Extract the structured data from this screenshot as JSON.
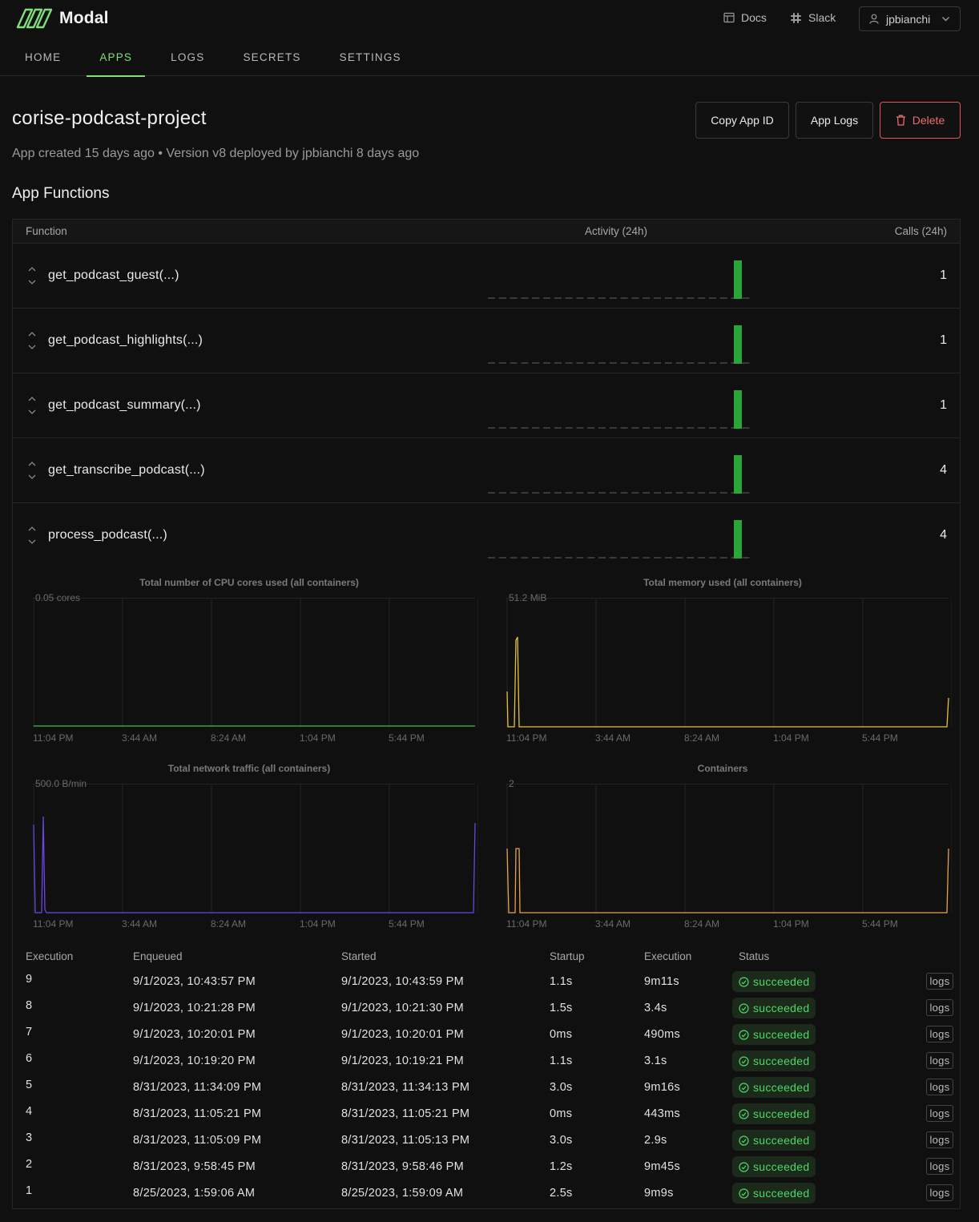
{
  "brand": {
    "name": "Modal"
  },
  "topnav": {
    "docs": "Docs",
    "slack": "Slack",
    "user": "jpbianchi"
  },
  "tabs": [
    "HOME",
    "APPS",
    "LOGS",
    "SECRETS",
    "SETTINGS"
  ],
  "active_tab": "APPS",
  "app": {
    "title": "corise-podcast-project",
    "subtitle": "App created 15 days ago • Version v8 deployed by jpbianchi 8 days ago",
    "buttons": {
      "copy_id": "Copy App ID",
      "app_logs": "App Logs",
      "delete": "Delete"
    }
  },
  "section_title": "App Functions",
  "functions_table": {
    "headers": {
      "function": "Function",
      "activity": "Activity (24h)",
      "calls": "Calls (24h)"
    },
    "rows": [
      {
        "name": "get_podcast_guest(...)",
        "calls": "1",
        "activity": 1
      },
      {
        "name": "get_podcast_highlights(...)",
        "calls": "1",
        "activity": 1
      },
      {
        "name": "get_podcast_summary(...)",
        "calls": "1",
        "activity": 1
      },
      {
        "name": "get_transcribe_podcast(...)",
        "calls": "4",
        "activity": 4
      },
      {
        "name": "process_podcast(...)",
        "calls": "4",
        "activity": 4
      }
    ]
  },
  "charts": {
    "cpu": {
      "title": "Total number of CPU cores used (all containers)",
      "ymax": "0.05 cores",
      "color": "#3bbf4a"
    },
    "memory": {
      "title": "Total memory used (all containers)",
      "ymax": "51.2 MiB",
      "color": "#e8c33a"
    },
    "network": {
      "title": "Total network traffic (all containers)",
      "ymax": "500.0 B/min",
      "color": "#6b46e0"
    },
    "containers": {
      "title": "Containers",
      "ymax": "2",
      "color": "#e8a24a"
    },
    "xticks": [
      "11:04 PM",
      "3:44 AM",
      "8:24 AM",
      "1:04 PM",
      "5:44 PM"
    ]
  },
  "executions": {
    "headers": {
      "execution": "Execution",
      "enqueued": "Enqueued",
      "started": "Started",
      "startup": "Startup",
      "exec": "Execution",
      "status": "Status"
    },
    "logs_label": "logs",
    "rows": [
      {
        "id": "9",
        "enqueued": "9/1/2023, 10:43:57 PM",
        "started": "9/1/2023, 10:43:59 PM",
        "startup": "1.1s",
        "execution": "9m11s",
        "status": "succeeded"
      },
      {
        "id": "8",
        "enqueued": "9/1/2023, 10:21:28 PM",
        "started": "9/1/2023, 10:21:30 PM",
        "startup": "1.5s",
        "execution": "3.4s",
        "status": "succeeded"
      },
      {
        "id": "7",
        "enqueued": "9/1/2023, 10:20:01 PM",
        "started": "9/1/2023, 10:20:01 PM",
        "startup": "0ms",
        "execution": "490ms",
        "status": "succeeded"
      },
      {
        "id": "6",
        "enqueued": "9/1/2023, 10:19:20 PM",
        "started": "9/1/2023, 10:19:21 PM",
        "startup": "1.1s",
        "execution": "3.1s",
        "status": "succeeded"
      },
      {
        "id": "5",
        "enqueued": "8/31/2023, 11:34:09 PM",
        "started": "8/31/2023, 11:34:13 PM",
        "startup": "3.0s",
        "execution": "9m16s",
        "status": "succeeded"
      },
      {
        "id": "4",
        "enqueued": "8/31/2023, 11:05:21 PM",
        "started": "8/31/2023, 11:05:21 PM",
        "startup": "0ms",
        "execution": "443ms",
        "status": "succeeded"
      },
      {
        "id": "3",
        "enqueued": "8/31/2023, 11:05:09 PM",
        "started": "8/31/2023, 11:05:13 PM",
        "startup": "3.0s",
        "execution": "2.9s",
        "status": "succeeded"
      },
      {
        "id": "2",
        "enqueued": "8/31/2023, 9:58:45 PM",
        "started": "8/31/2023, 9:58:46 PM",
        "startup": "1.2s",
        "execution": "9m45s",
        "status": "succeeded"
      },
      {
        "id": "1",
        "enqueued": "8/25/2023, 1:59:06 AM",
        "started": "8/25/2023, 1:59:09 AM",
        "startup": "2.5s",
        "execution": "9m9s",
        "status": "succeeded"
      }
    ]
  }
}
